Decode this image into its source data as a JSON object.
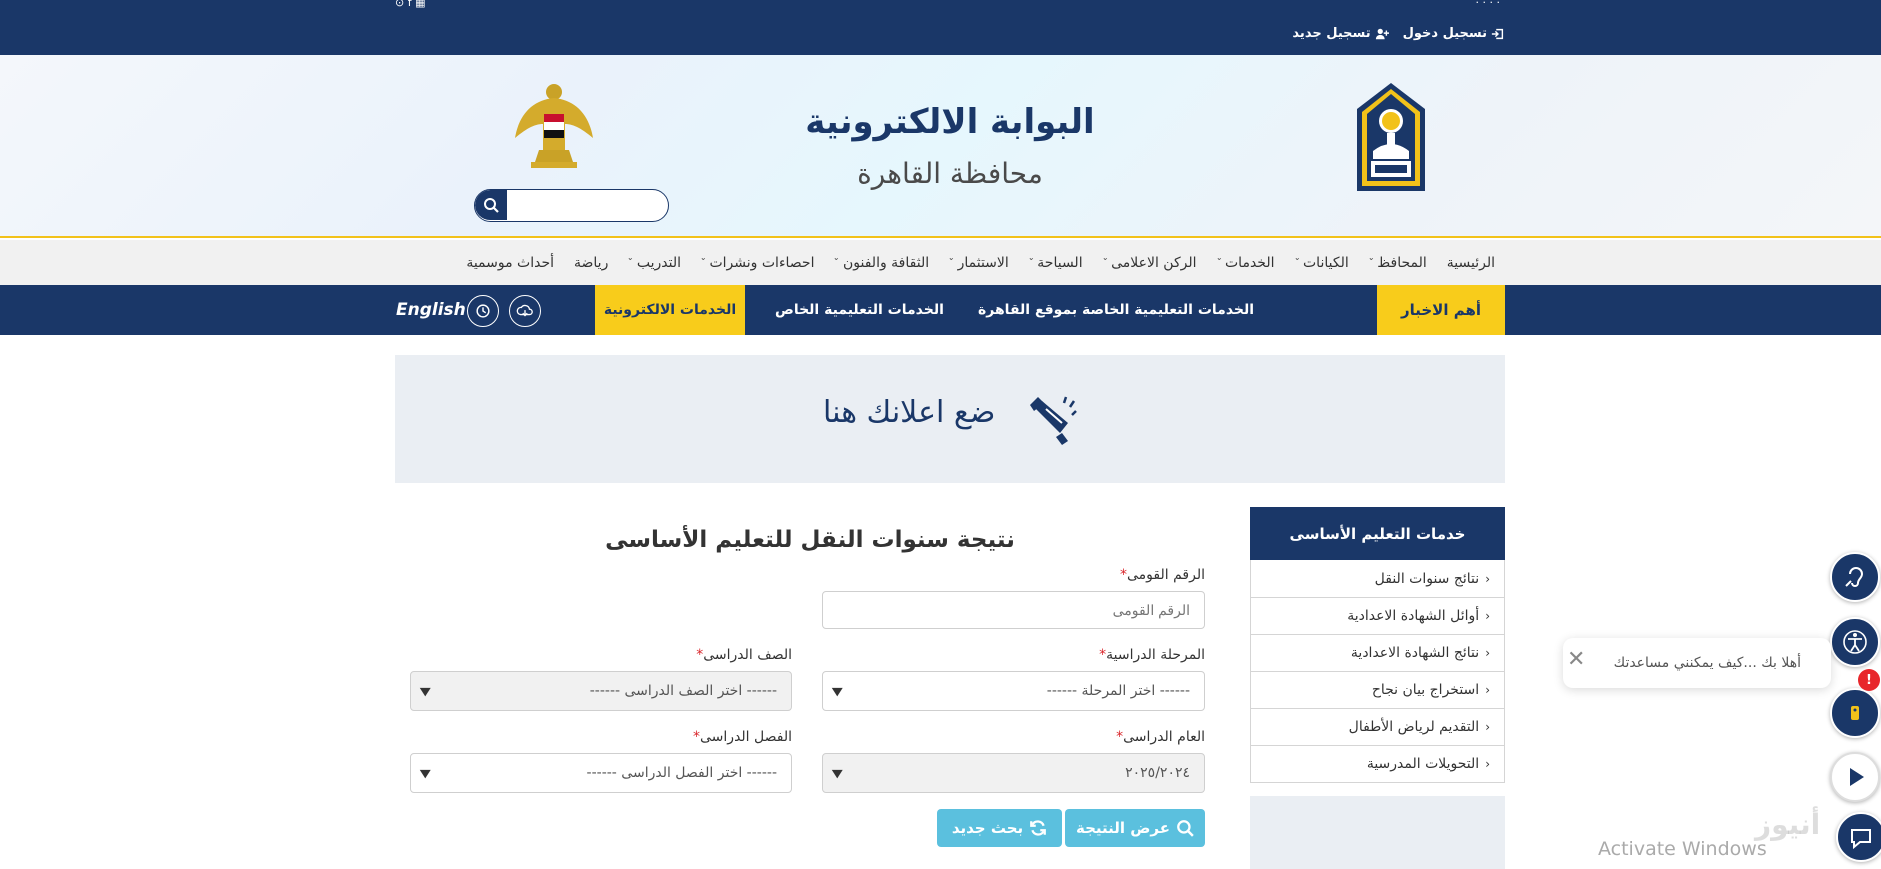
{
  "topbar": {
    "login_label": "تسجيل دخول",
    "register_label": "تسجيل جديد"
  },
  "header": {
    "title": "البوابة الالكترونية",
    "subtitle": "محافظة القاهرة",
    "search_placeholder": ""
  },
  "nav": {
    "items": [
      {
        "label": "الرئيسية",
        "has_dropdown": false
      },
      {
        "label": "المحافظ",
        "has_dropdown": true
      },
      {
        "label": "الكيانات",
        "has_dropdown": true
      },
      {
        "label": "الخدمات",
        "has_dropdown": true
      },
      {
        "label": "الركن الاعلامى",
        "has_dropdown": true
      },
      {
        "label": "السياحة",
        "has_dropdown": true
      },
      {
        "label": "الاستثمار",
        "has_dropdown": true
      },
      {
        "label": "الثقافة والفنون",
        "has_dropdown": true
      },
      {
        "label": "احصاءات ونشرات",
        "has_dropdown": true
      },
      {
        "label": "التدريب",
        "has_dropdown": true
      },
      {
        "label": "رياضة",
        "has_dropdown": false
      },
      {
        "label": "أحداث موسمية",
        "has_dropdown": false
      }
    ]
  },
  "bluebar": {
    "news_label": "أهم الاخبار",
    "link1": "الخدمات التعليمية الخاصة بموقع القاهرة",
    "link2": "الخدمات التعليمية الخاص",
    "eservices_label": "الخدمات الالكترونية",
    "english_label": "English"
  },
  "ad": {
    "text": "ضع اعلانك هنا"
  },
  "sidebar": {
    "title": "خدمات التعليم الأساسى",
    "items": [
      "نتائج سنوات النقل",
      "أوائل الشهادة الاعدادية",
      "نتائج الشهادة الاعدادية",
      "استخراج بيان نجاح",
      "التقديم لرياض الأطفال",
      "التحويلات المدرسية"
    ]
  },
  "form": {
    "title": "نتيجة سنوات النقل للتعليم الأساسى",
    "national_id_label": "الرقم القومى",
    "national_id_placeholder": "الرقم القومى",
    "stage_label": "المرحلة الدراسية",
    "stage_value": "------ اختر المرحلة ------",
    "grade_label": "الصف الدراسى",
    "grade_value": "------ اختر الصف الدراسى ------",
    "year_label": "العام الدراسى",
    "year_value": "٢٠٢٥/٢٠٢٤",
    "term_label": "الفصل الدراسى",
    "term_value": "------ اختر الفصل الدراسى ------",
    "required_mark": "*",
    "show_result_label": "عرض النتيجة",
    "new_search_label": "بحث جديد"
  },
  "widgets": {
    "chat_text": "أهلا بك ...كيف يمكنني مساعدتك",
    "badge": "!",
    "activate_text": "Activate Windows",
    "watermark": "أنيوز"
  },
  "colors": {
    "navy": "#1a3768",
    "yellow": "#f8cc1b",
    "info_button": "#5bc0de"
  }
}
